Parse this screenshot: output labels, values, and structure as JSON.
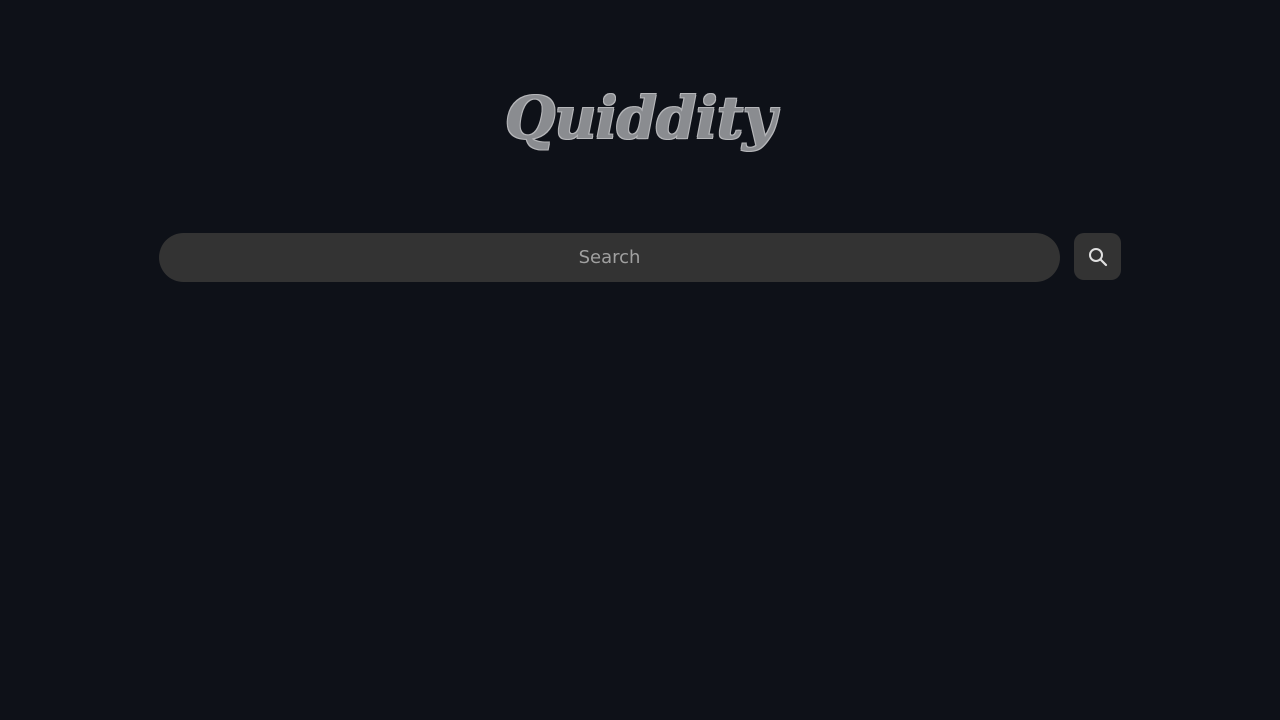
{
  "logo": {
    "text": "Quiddity"
  },
  "search": {
    "placeholder": "Search",
    "value": "",
    "button_icon": "search-icon"
  },
  "colors": {
    "background": "#0e1118",
    "surface": "#333333",
    "logo": "#8a8c90",
    "placeholder": "#a0a0a0",
    "icon": "#e0e0e0"
  }
}
